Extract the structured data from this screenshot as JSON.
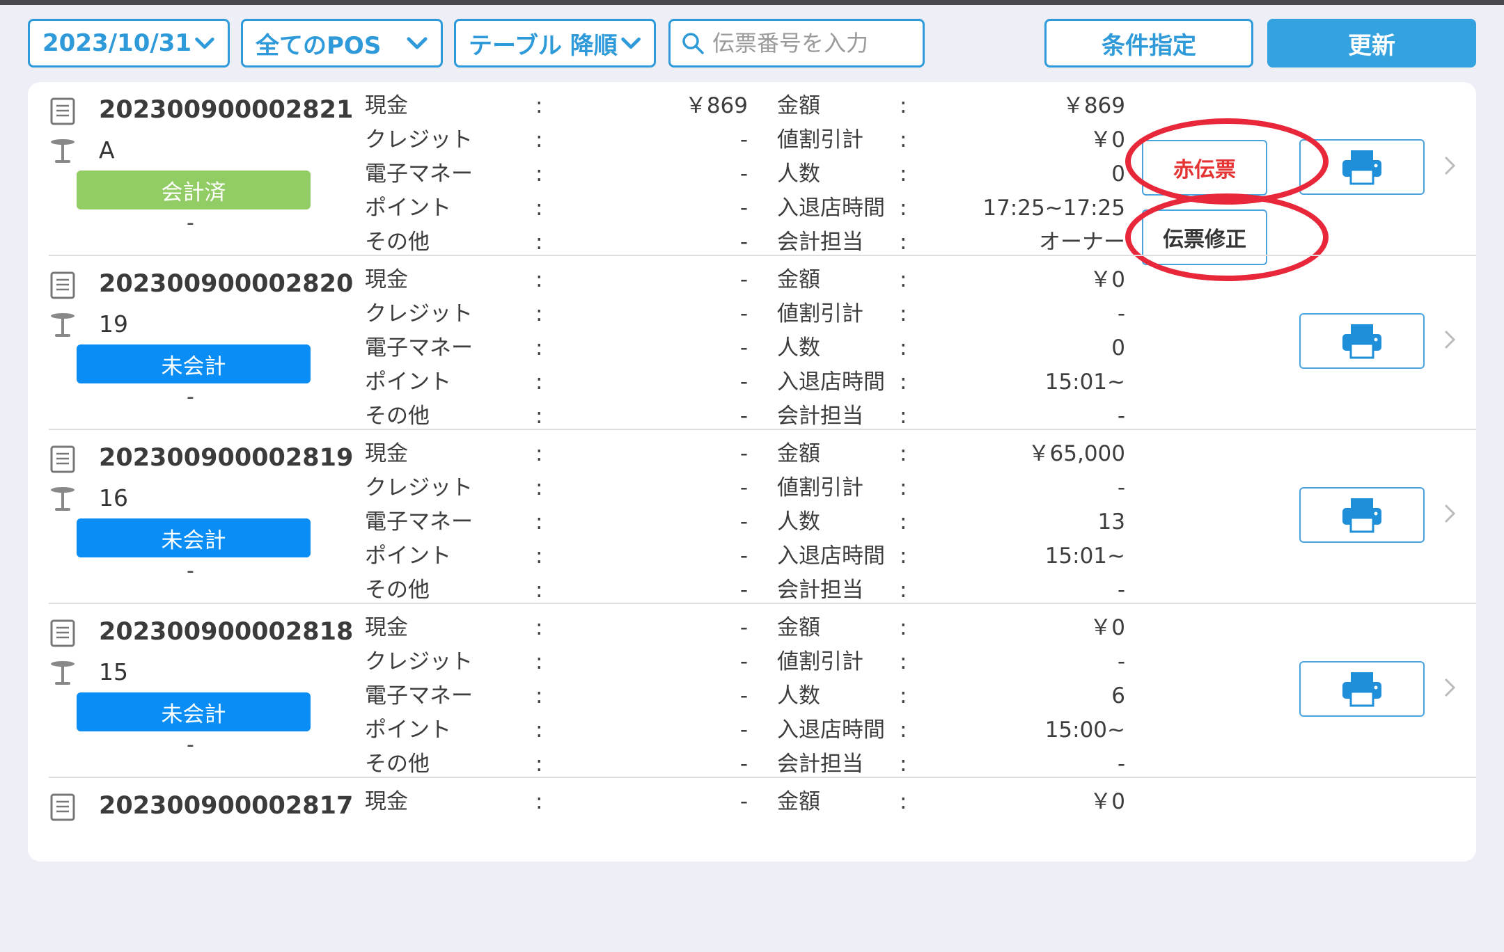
{
  "toolbar": {
    "date": "2023/10/31",
    "pos": "全てのPOS",
    "sort": "テーブル 降順",
    "search_placeholder": "伝票番号を入力",
    "conditions_label": "条件指定",
    "refresh_label": "更新"
  },
  "labels": {
    "cash": "現金",
    "credit": "クレジット",
    "emoney": "電子マネー",
    "point": "ポイント",
    "other": "その他",
    "amount": "金額",
    "discount": "値割引計",
    "people": "人数",
    "time": "入退店時間",
    "staff": "会計担当",
    "colon": ":"
  },
  "actions": {
    "red_slip": "赤伝票",
    "edit_slip": "伝票修正"
  },
  "rows": [
    {
      "slip": "202300900002821",
      "table": "A",
      "status": "会計済",
      "sub": "-",
      "cash": "￥869",
      "credit": "-",
      "emoney": "-",
      "point": "-",
      "other": "-",
      "amount": "￥869",
      "discount": "￥0",
      "people": "0",
      "time": "17:25~17:25",
      "staff": "オーナー"
    },
    {
      "slip": "202300900002820",
      "table": "19",
      "status": "未会計",
      "sub": "-",
      "cash": "-",
      "credit": "-",
      "emoney": "-",
      "point": "-",
      "other": "-",
      "amount": "￥0",
      "discount": "-",
      "people": "0",
      "time": "15:01~",
      "staff": "-"
    },
    {
      "slip": "202300900002819",
      "table": "16",
      "status": "未会計",
      "sub": "-",
      "cash": "-",
      "credit": "-",
      "emoney": "-",
      "point": "-",
      "other": "-",
      "amount": "￥65,000",
      "discount": "-",
      "people": "13",
      "time": "15:01~",
      "staff": "-"
    },
    {
      "slip": "202300900002818",
      "table": "15",
      "status": "未会計",
      "sub": "-",
      "cash": "-",
      "credit": "-",
      "emoney": "-",
      "point": "-",
      "other": "-",
      "amount": "￥0",
      "discount": "-",
      "people": "6",
      "time": "15:00~",
      "staff": "-"
    },
    {
      "slip": "202300900002817",
      "cash": "-",
      "amount": "￥0"
    }
  ],
  "colors": {
    "accent": "#2e9ad9",
    "paid": "#92cc64",
    "unpaid": "#0a8ef5",
    "highlight": "#e8283a"
  }
}
